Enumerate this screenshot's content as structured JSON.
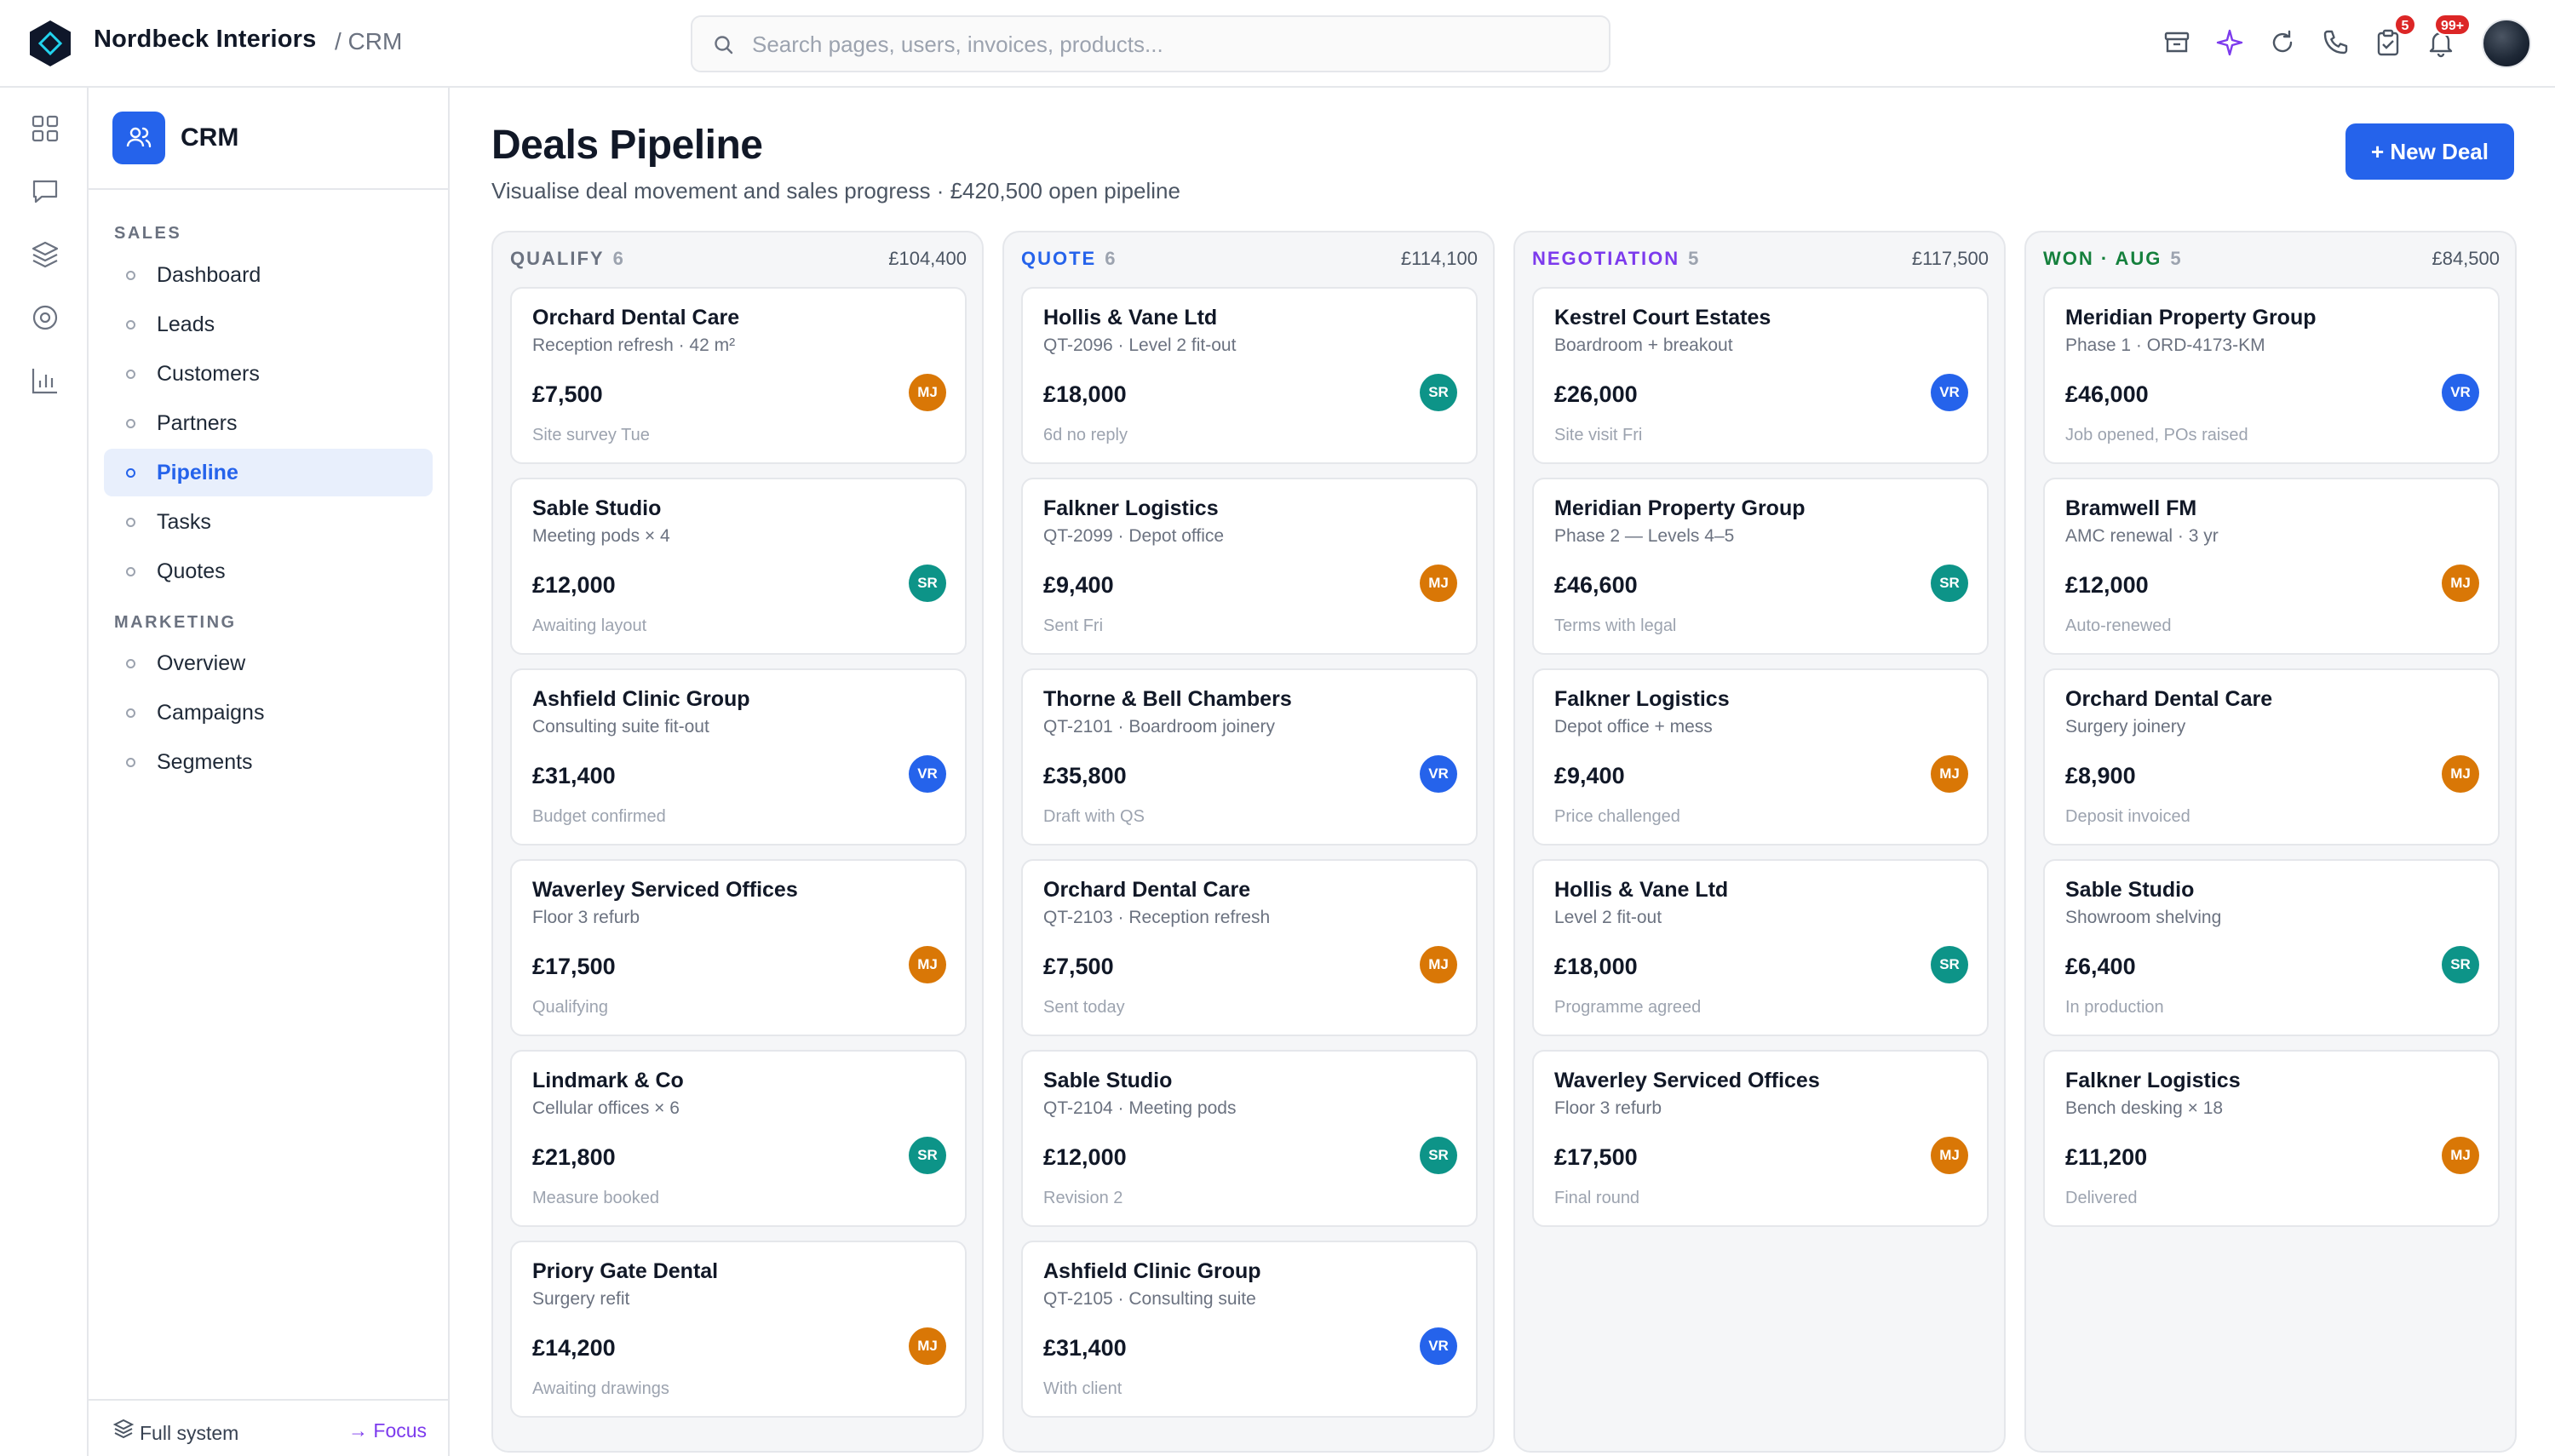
{
  "app": {
    "brand": "Nordbeck Interiors",
    "breadcrumb": "/ CRM",
    "search_placeholder": "Search pages, users, invoices, products...",
    "top_icons": [
      "archive-icon",
      "sparkle-icon",
      "refresh-icon",
      "phone-icon",
      "tasks-icon",
      "bell-icon"
    ],
    "badges": {
      "tasks": "5",
      "notifications": "99+"
    }
  },
  "rail": {
    "icons": [
      "grid-icon",
      "chat-icon",
      "layers-icon",
      "target-icon",
      "bar-chart-icon"
    ]
  },
  "sidebar": {
    "title": "CRM",
    "sections": [
      {
        "label": "SALES",
        "items": [
          "Dashboard",
          "Leads",
          "Customers",
          "Partners",
          "Pipeline",
          "Tasks",
          "Quotes"
        ]
      },
      {
        "label": "MARKETING",
        "items": [
          "Overview",
          "Campaigns",
          "Segments"
        ]
      }
    ],
    "active": "Pipeline",
    "footer": {
      "full_system": "Full system",
      "focus": "→ Focus"
    }
  },
  "main": {
    "title": "Deals Pipeline",
    "subtitle": "Visualise deal movement and sales progress · £420,500 open pipeline",
    "new_deal_label": "+ New Deal"
  },
  "colors": {
    "accent": "#2563eb",
    "qualify": "#6b7280",
    "quote": "#2563eb",
    "negotiation": "#7c3aed",
    "won": "#15803d",
    "avatar_MJ": "#d97706",
    "avatar_SR": "#0d9488",
    "avatar_VR": "#2563eb",
    "badge": "#dc2626"
  },
  "columns": [
    {
      "name": "QUALIFY",
      "count": "6",
      "total": "£104,400",
      "color": "#6b7280",
      "cards": [
        {
          "name": "Orchard Dental Care",
          "sub": "Reception refresh · 42 m²",
          "value": "£7,500",
          "owner": "MJ",
          "note": "Site survey Tue"
        },
        {
          "name": "Sable Studio",
          "sub": "Meeting pods × 4",
          "value": "£12,000",
          "owner": "SR",
          "note": "Awaiting layout"
        },
        {
          "name": "Ashfield Clinic Group",
          "sub": "Consulting suite fit-out",
          "value": "£31,400",
          "owner": "VR",
          "note": "Budget confirmed"
        },
        {
          "name": "Waverley Serviced Offices",
          "sub": "Floor 3 refurb",
          "value": "£17,500",
          "owner": "MJ",
          "note": "Qualifying"
        },
        {
          "name": "Lindmark & Co",
          "sub": "Cellular offices × 6",
          "value": "£21,800",
          "owner": "SR",
          "note": "Measure booked"
        },
        {
          "name": "Priory Gate Dental",
          "sub": "Surgery refit",
          "value": "£14,200",
          "owner": "MJ",
          "note": "Awaiting drawings"
        }
      ]
    },
    {
      "name": "QUOTE",
      "count": "6",
      "total": "£114,100",
      "color": "#2563eb",
      "cards": [
        {
          "name": "Hollis & Vane Ltd",
          "sub": "QT-2096 · Level 2 fit-out",
          "value": "£18,000",
          "owner": "SR",
          "note": "6d no reply"
        },
        {
          "name": "Falkner Logistics",
          "sub": "QT-2099 · Depot office",
          "value": "£9,400",
          "owner": "MJ",
          "note": "Sent Fri"
        },
        {
          "name": "Thorne & Bell Chambers",
          "sub": "QT-2101 · Boardroom joinery",
          "value": "£35,800",
          "owner": "VR",
          "note": "Draft with QS"
        },
        {
          "name": "Orchard Dental Care",
          "sub": "QT-2103 · Reception refresh",
          "value": "£7,500",
          "owner": "MJ",
          "note": "Sent today"
        },
        {
          "name": "Sable Studio",
          "sub": "QT-2104 · Meeting pods",
          "value": "£12,000",
          "owner": "SR",
          "note": "Revision 2"
        },
        {
          "name": "Ashfield Clinic Group",
          "sub": "QT-2105 · Consulting suite",
          "value": "£31,400",
          "owner": "VR",
          "note": "With client"
        }
      ]
    },
    {
      "name": "NEGOTIATION",
      "count": "5",
      "total": "£117,500",
      "color": "#7c3aed",
      "cards": [
        {
          "name": "Kestrel Court Estates",
          "sub": "Boardroom + breakout",
          "value": "£26,000",
          "owner": "VR",
          "note": "Site visit Fri"
        },
        {
          "name": "Meridian Property Group",
          "sub": "Phase 2 — Levels 4–5",
          "value": "£46,600",
          "owner": "SR",
          "note": "Terms with legal"
        },
        {
          "name": "Falkner Logistics",
          "sub": "Depot office + mess",
          "value": "£9,400",
          "owner": "MJ",
          "note": "Price challenged"
        },
        {
          "name": "Hollis & Vane Ltd",
          "sub": "Level 2 fit-out",
          "value": "£18,000",
          "owner": "SR",
          "note": "Programme agreed"
        },
        {
          "name": "Waverley Serviced Offices",
          "sub": "Floor 3 refurb",
          "value": "£17,500",
          "owner": "MJ",
          "note": "Final round"
        }
      ]
    },
    {
      "name": "WON · AUG",
      "count": "5",
      "total": "£84,500",
      "color": "#15803d",
      "cards": [
        {
          "name": "Meridian Property Group",
          "sub": "Phase 1 · ORD-4173-KM",
          "value": "£46,000",
          "owner": "VR",
          "note": "Job opened, POs raised"
        },
        {
          "name": "Bramwell FM",
          "sub": "AMC renewal · 3 yr",
          "value": "£12,000",
          "owner": "MJ",
          "note": "Auto-renewed"
        },
        {
          "name": "Orchard Dental Care",
          "sub": "Surgery joinery",
          "value": "£8,900",
          "owner": "MJ",
          "note": "Deposit invoiced"
        },
        {
          "name": "Sable Studio",
          "sub": "Showroom shelving",
          "value": "£6,400",
          "owner": "SR",
          "note": "In production"
        },
        {
          "name": "Falkner Logistics",
          "sub": "Bench desking × 18",
          "value": "£11,200",
          "owner": "MJ",
          "note": "Delivered"
        }
      ]
    }
  ]
}
